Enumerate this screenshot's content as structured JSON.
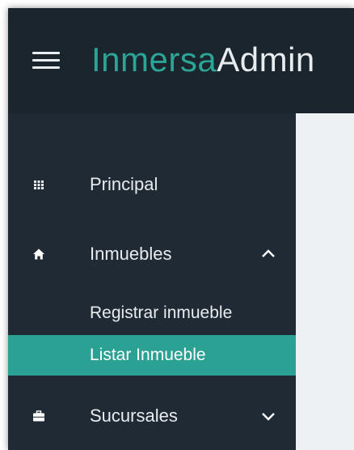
{
  "header": {
    "brand_primary": "Inmersa",
    "brand_secondary": "Admin",
    "menu_icon": "hamburger-menu-icon"
  },
  "colors": {
    "accent": "#2aa193",
    "sidebar_bg": "#1f2a34",
    "header_bg": "#1b252e",
    "content_bg": "#eef1f3"
  },
  "sidebar": {
    "items": [
      {
        "label": "Principal",
        "icon": "grid-icon"
      },
      {
        "label": "Inmuebles",
        "icon": "home-icon",
        "expanded": true,
        "chevron": "chevron-up-icon",
        "children": [
          {
            "label": "Registrar inmueble",
            "active": false
          },
          {
            "label": "Listar Inmueble",
            "active": true
          }
        ]
      },
      {
        "label": "Sucursales",
        "icon": "briefcase-icon",
        "expanded": false,
        "chevron": "chevron-down-icon"
      }
    ]
  }
}
